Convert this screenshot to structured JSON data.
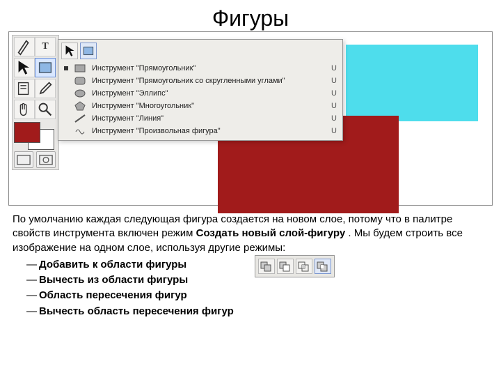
{
  "title": "Фигуры",
  "tools": {
    "items": [
      {
        "name": "pen-icon"
      },
      {
        "name": "type-icon"
      },
      {
        "name": "path-select-icon"
      },
      {
        "name": "shape-tool-icon",
        "selected": true
      },
      {
        "name": "notes-icon"
      },
      {
        "name": "eyedropper-icon"
      },
      {
        "name": "hand-icon"
      },
      {
        "name": "zoom-icon"
      }
    ],
    "fg_color": "#a11b1b",
    "bg_color": "#ffffff"
  },
  "flyout": {
    "head": [
      {
        "name": "pointer-icon"
      },
      {
        "name": "shape-tool-icon",
        "selected": true
      }
    ],
    "items": [
      {
        "shape": "rect",
        "label": "Инструмент \"Прямоугольник\"",
        "key": "U",
        "selected": true
      },
      {
        "shape": "roundrect",
        "label": "Инструмент \"Прямоугольник со скругленными углами\"",
        "key": "U"
      },
      {
        "shape": "ellipse",
        "label": "Инструмент \"Эллипс\"",
        "key": "U"
      },
      {
        "shape": "polygon",
        "label": "Инструмент \"Многоугольник\"",
        "key": "U"
      },
      {
        "shape": "line",
        "label": "Инструмент \"Линия\"",
        "key": "U"
      },
      {
        "shape": "custom",
        "label": "Инструмент \"Произвольная фигура\"",
        "key": "U"
      }
    ]
  },
  "paragraph": {
    "p1": "По умолчанию каждая следующая фигура создается на новом слое, потому что в палитре свойств инструмента включен режим ",
    "p1_bold": "Создать новый слой-фигуру",
    "p1_tail": "  . Мы будем строить все изображение на одном слое, используя другие режимы:",
    "bullets": [
      "Добавить к области фигуры",
      "Вычесть из области фигуры",
      "Область пересечения фигур",
      "Вычесть область пересечения фигур"
    ],
    "dash": "— "
  }
}
